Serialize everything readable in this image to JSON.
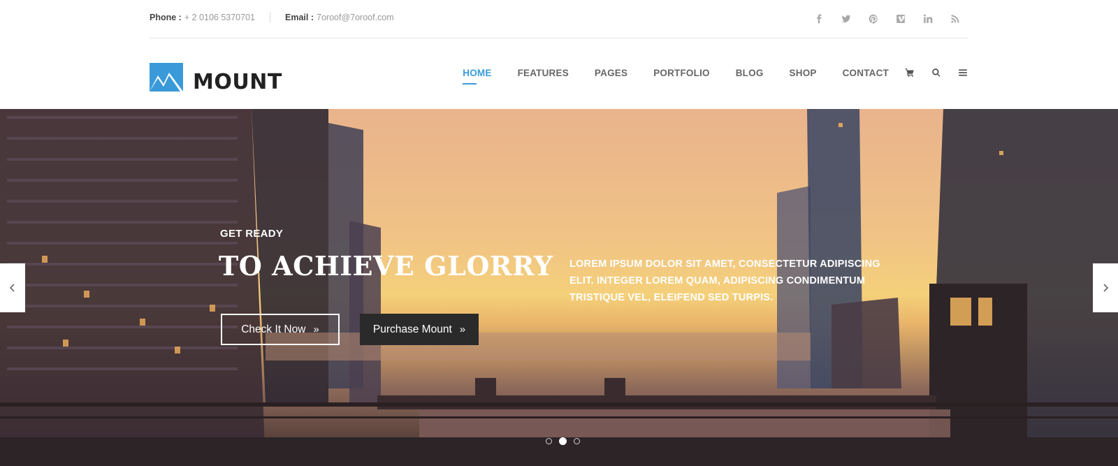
{
  "topbar": {
    "phone_label": "Phone :",
    "phone_value": "+ 2 0106 5370701",
    "email_label": "Email :",
    "email_value": "7oroof@7oroof.com",
    "social_icons": [
      "facebook-icon",
      "twitter-icon",
      "pinterest-icon",
      "vimeo-icon",
      "linkedin-icon",
      "rss-icon"
    ]
  },
  "header": {
    "logo_text": "MOUNT",
    "nav": [
      {
        "label": "HOME",
        "active": true
      },
      {
        "label": "FEATURES"
      },
      {
        "label": "PAGES"
      },
      {
        "label": "PORTFOLIO"
      },
      {
        "label": "BLOG"
      },
      {
        "label": "SHOP"
      },
      {
        "label": "CONTACT"
      }
    ],
    "icons": [
      "cart-icon",
      "search-icon",
      "menu-icon"
    ]
  },
  "hero": {
    "eyebrow": "GET READY",
    "title": "TO ACHIEVE GLORRY",
    "description": "LOREM IPSUM DOLOR SIT AMET, CONSECTETUR ADIPISCING ELIT. INTEGER LOREM QUAM, ADIPISCING CONDIMENTUM TRISTIQUE VEL, ELEIFEND SED TURPIS.",
    "btn_primary": "Check It Now",
    "btn_secondary": "Purchase Mount",
    "slide_count": 3,
    "active_slide": 2
  },
  "colors": {
    "accent": "#3a9ad9",
    "dark_button": "#2a2a2a",
    "nav_text": "#666666"
  }
}
